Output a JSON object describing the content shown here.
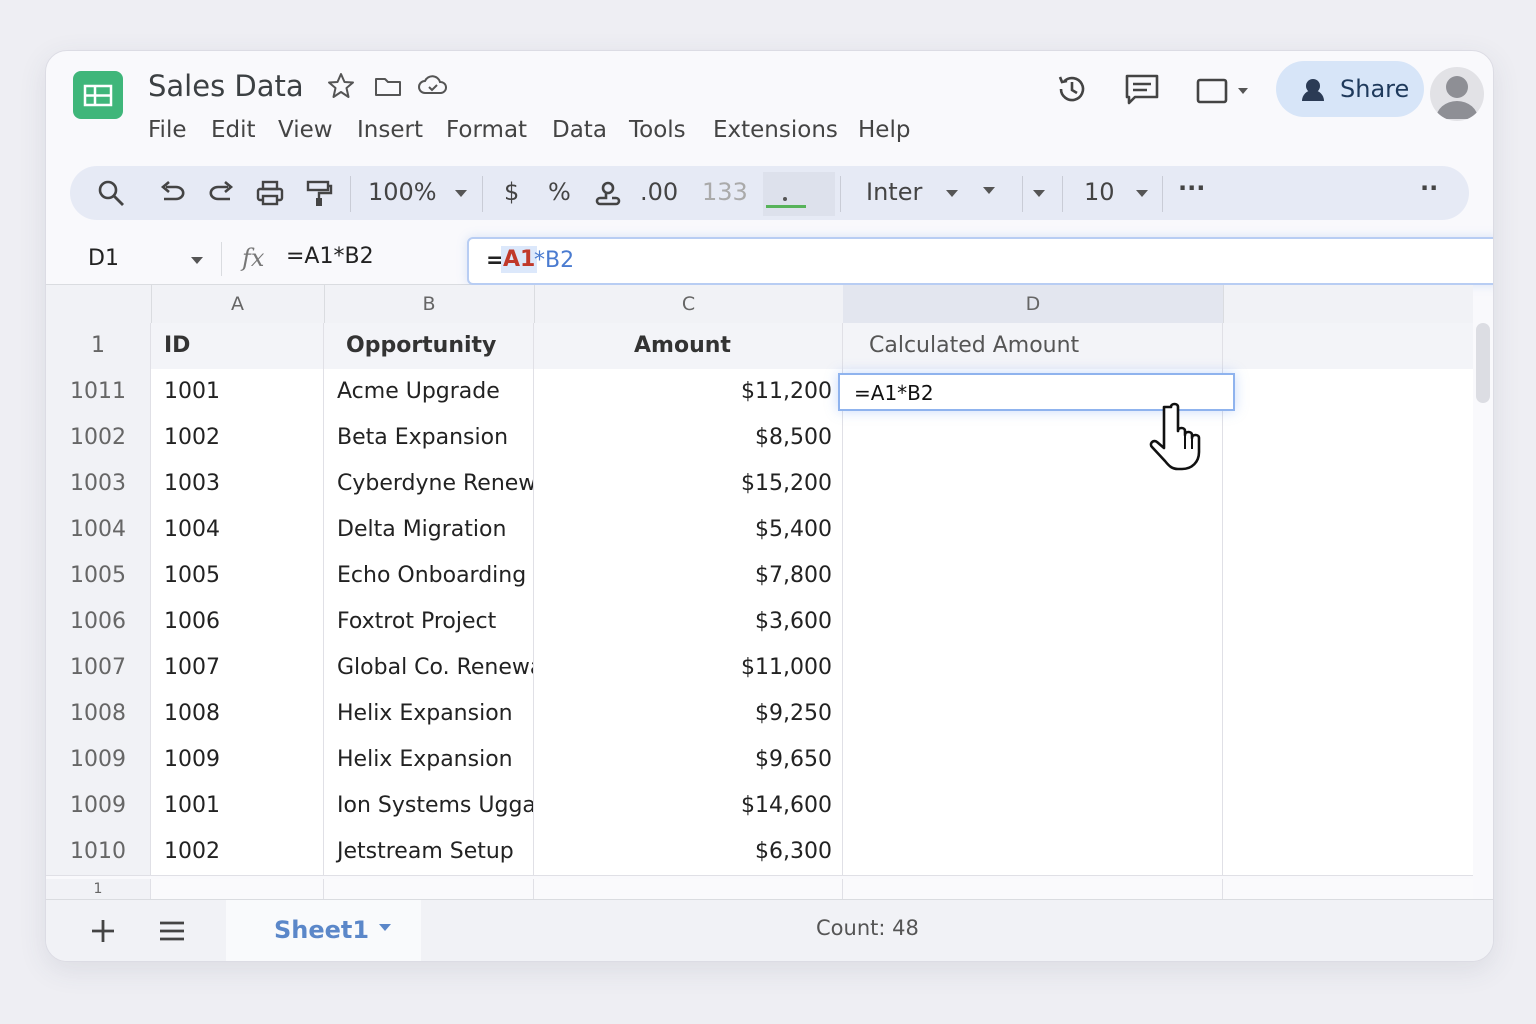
{
  "app": {
    "doc_title": "Sales Data",
    "share_label": "Share",
    "accent_color": "#3fb67a",
    "icons": [
      "star-icon",
      "folder-icon",
      "cloud-icon",
      "history-icon",
      "comment-icon",
      "present-icon",
      "avatar-icon"
    ]
  },
  "menu": [
    "File",
    "Edit",
    "View",
    "Insert",
    "Format",
    "Data",
    "Tools",
    "Extensions",
    "Help"
  ],
  "toolbar": {
    "zoom": "100%",
    "currency": "$",
    "percent": "%",
    "decimal": ".00",
    "number_format": "133",
    "font": "Inter",
    "font_size": "10",
    "more": "···",
    "more2": "··"
  },
  "formula_bar": {
    "name_box": "D1",
    "fx": "fx",
    "formula": "=A1*B2",
    "edit_eq": "=",
    "edit_ref1": "A1",
    "edit_rest": "*B2"
  },
  "grid": {
    "columns": [
      "A",
      "B",
      "C",
      "D"
    ],
    "header_row": {
      "rownum": "1",
      "id": "ID",
      "opportunity": "Opportunity",
      "amount": "Amount",
      "calc": "Calculated Amount"
    },
    "rows": [
      {
        "rownum": "1011",
        "id": "1001",
        "opportunity": "Acme Upgrade",
        "amount": "$11,200"
      },
      {
        "rownum": "1002",
        "id": "1002",
        "opportunity": "Beta Expansion",
        "amount": "$8,500"
      },
      {
        "rownum": "1003",
        "id": "1003",
        "opportunity": "Cyberdyne Renewal",
        "amount": "$15,200"
      },
      {
        "rownum": "1004",
        "id": "1004",
        "opportunity": "Delta Migration",
        "amount": "$5,400"
      },
      {
        "rownum": "1005",
        "id": "1005",
        "opportunity": "Echo Onboarding",
        "amount": "$7,800"
      },
      {
        "rownum": "1006",
        "id": "1006",
        "opportunity": "Foxtrot Project",
        "amount": "$3,600"
      },
      {
        "rownum": "1007",
        "id": "1007",
        "opportunity": "Global Co. Renewal",
        "amount": "$11,000"
      },
      {
        "rownum": "1008",
        "id": "1008",
        "opportunity": "Helix Expansion",
        "amount": "$9,250"
      },
      {
        "rownum": "1009",
        "id": "1009",
        "opportunity": "Helix Expansion",
        "amount": "$9,650"
      },
      {
        "rownum": "1009",
        "id": "1001",
        "opportunity": "Ion Systems Uggade",
        "amount": "$14,600"
      },
      {
        "rownum": "1010",
        "id": "1002",
        "opportunity": "Jetstream Setup",
        "amount": "$6,300"
      }
    ],
    "partial_row_num": "1",
    "active_cell_value": "=A1*B2"
  },
  "footer": {
    "sheet_tab": "Sheet1",
    "status": "Count: 48"
  }
}
